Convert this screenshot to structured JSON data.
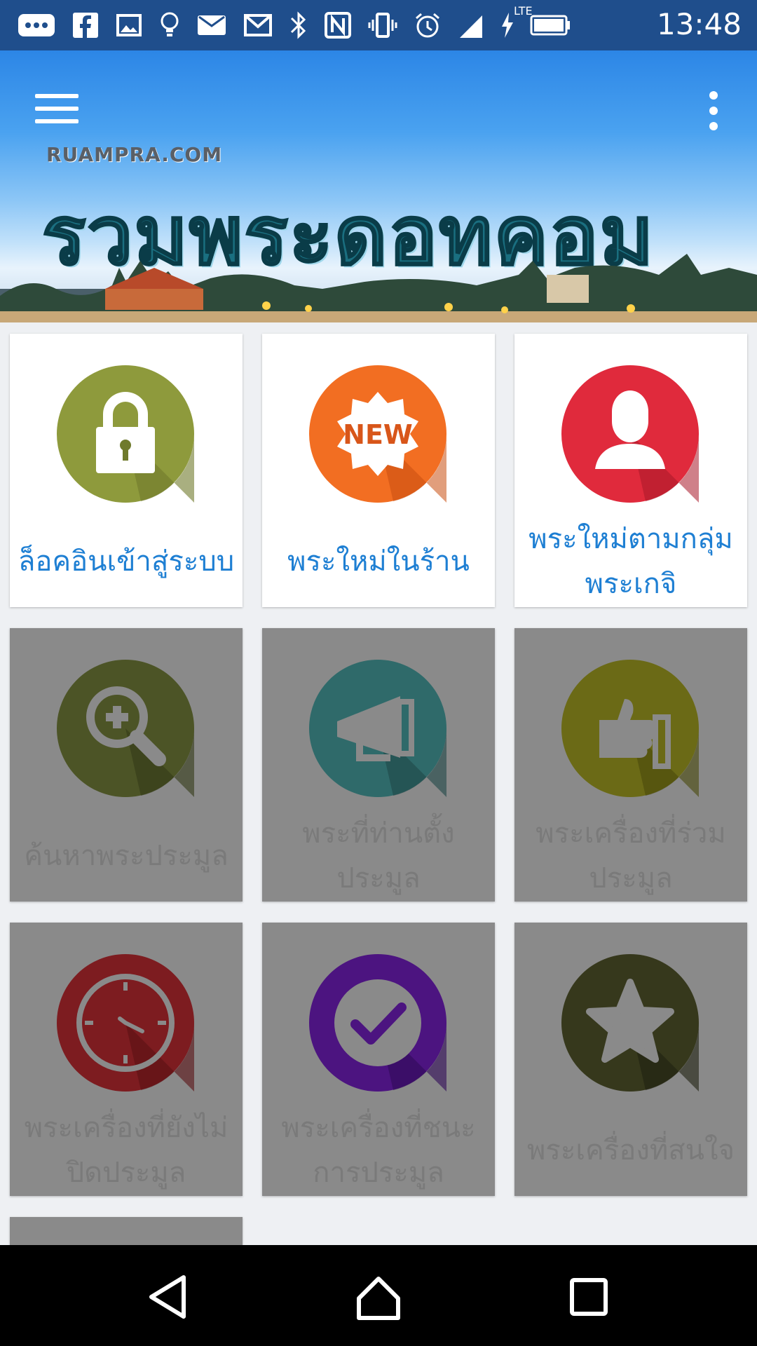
{
  "status_bar": {
    "time": "13:48",
    "network": "LTE",
    "icons": [
      "more-icon",
      "facebook-icon",
      "image-icon",
      "lightbulb-icon",
      "mail-icon",
      "gmail-icon",
      "bluetooth-icon",
      "nfc-icon",
      "vibrate-icon",
      "alarm-icon",
      "signal-icon",
      "charging-icon",
      "battery-icon"
    ]
  },
  "banner": {
    "site_tag": "RUAMPRA.COM",
    "logo_text": "รวมพระดอทคอม"
  },
  "tiles": [
    {
      "label": "ล็อคอินเข้าสู่ระบบ",
      "icon": "lock-icon",
      "color": "#8e9a3c",
      "enabled": true
    },
    {
      "label": "พระใหม่ในร้าน",
      "icon": "new-badge-icon",
      "color": "#f26e22",
      "enabled": true,
      "badge_text": "NEW"
    },
    {
      "label": "พระใหม่ตามกลุ่มพระเกจิ",
      "icon": "user-icon",
      "color": "#e02a3c",
      "enabled": true
    },
    {
      "label": "ค้นหาพระประมูล",
      "icon": "zoom-in-icon",
      "color": "#4c5426",
      "enabled": false
    },
    {
      "label": "พระที่ท่านตั้งประมูล",
      "icon": "megaphone-icon",
      "color": "#2f6a6a",
      "enabled": false
    },
    {
      "label": "พระเครื่องที่ร่วมประมูล",
      "icon": "thumbs-up-icon",
      "color": "#6b6a16",
      "enabled": false
    },
    {
      "label": "พระเครื่องที่ยังไม่ปิดประมูล",
      "icon": "clock-icon",
      "color": "#7d1c20",
      "enabled": false
    },
    {
      "label": "พระเครื่องที่ชนะการประมูล",
      "icon": "check-icon",
      "color": "#4c1480",
      "enabled": false
    },
    {
      "label": "พระเครื่องที่สนใจ",
      "icon": "star-icon",
      "color": "#36381c",
      "enabled": false
    }
  ],
  "colors": {
    "status_bar": "#1f4e8c",
    "label_enabled": "#1e7fd3",
    "tile_disabled": "#8a8a8a"
  }
}
